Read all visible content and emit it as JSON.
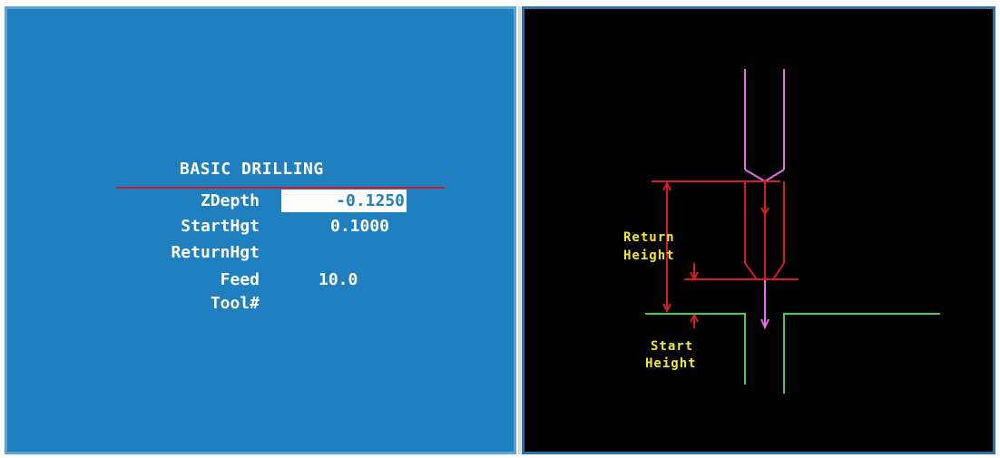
{
  "form": {
    "title": "BASIC DRILLING",
    "fields": [
      {
        "label": "ZDepth",
        "value": "-0.1250",
        "active": true
      },
      {
        "label": "StartHgt",
        "value": "0.1000",
        "active": false
      },
      {
        "label": "ReturnHgt",
        "value": "",
        "active": false
      },
      {
        "label": "Feed",
        "value": "10.0",
        "active": false
      },
      {
        "label": "Tool#",
        "value": "",
        "active": false
      }
    ]
  },
  "diagram": {
    "return_height_label": [
      "Return",
      "Height"
    ],
    "start_height_label": [
      "Start",
      "Height"
    ]
  },
  "colors": {
    "form_background": "#1f7fbf",
    "diagram_background": "#000000",
    "title_rule": "#c21f2b",
    "tool_outline": "#e36fe5",
    "dimension_lines": "#d71c25",
    "part_surface": "#3fd14c",
    "diagram_text": "#f1e53b"
  }
}
